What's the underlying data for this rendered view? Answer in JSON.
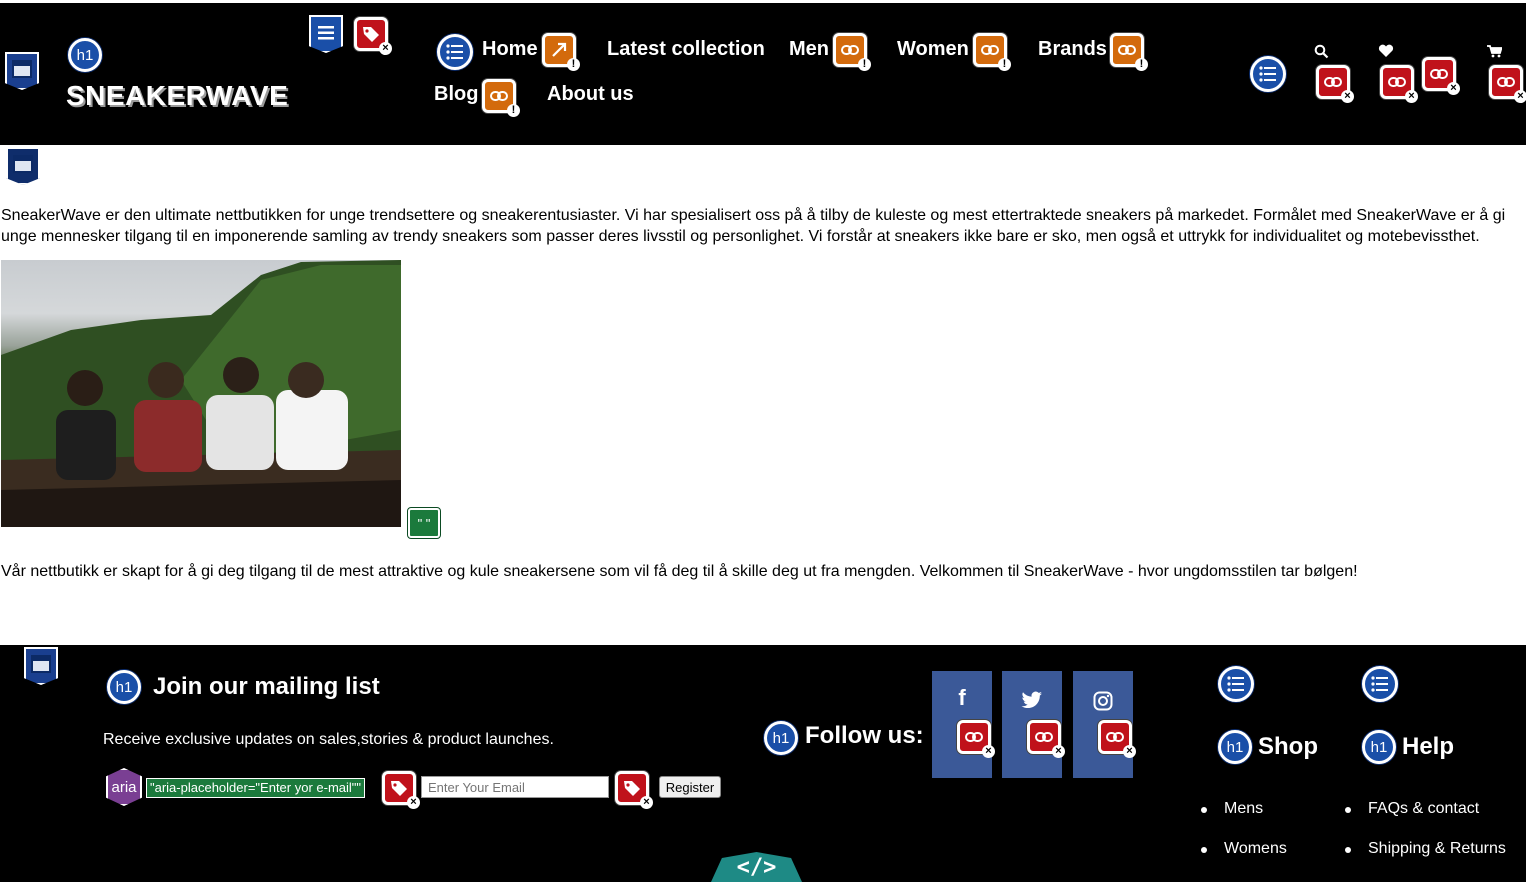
{
  "brand": {
    "logo_text": "SNEAKERWAVE"
  },
  "nav": {
    "items": [
      {
        "label": "Home"
      },
      {
        "label": "Latest collection"
      },
      {
        "label": "Men"
      },
      {
        "label": "Women"
      },
      {
        "label": "Brands"
      },
      {
        "label": "Blog"
      },
      {
        "label": "About us"
      }
    ]
  },
  "header_icons": [
    "search-icon",
    "heart-icon",
    "cart-icon"
  ],
  "main": {
    "intro": "SneakerWave er den ultimate nettbutikken for unge trendsettere og sneakerentusiaster. Vi har spesialisert oss på å tilby de kuleste og mest ettertraktede sneakers på markedet. Formålet med SneakerWave er å gi unge mennesker tilgang til en imponerende samling av trendy sneakers som passer deres livsstil og personlighet. Vi forstår at sneakers ikke bare er sko, men også et uttrykk for individualitet og motebevissthet.",
    "outro": "Vår nettbutikk er skapt for å gi deg tilgang til de mest attraktive og kule sneakersene som vil få deg til å skille deg ut fra mengden. Velkommen til SneakerWave - hvor ungdomsstilen tar bølgen!",
    "hero_alt_badge": "\" \""
  },
  "footer": {
    "mailing_title": "Join our mailing list",
    "mailing_text": "Receive exclusive updates on sales,stories & product launches.",
    "aria_note": "\"aria-placeholder=\"Enter yor e-mail\"\"",
    "email_placeholder": "Enter Your Email",
    "register_label": "Register",
    "follow_title": "Follow us:",
    "social": [
      "facebook-icon",
      "twitter-icon",
      "instagram-icon"
    ],
    "shop": {
      "title": "Shop",
      "items": [
        "Mens",
        "Womens"
      ]
    },
    "help": {
      "title": "Help",
      "items": [
        "FAQs & contact",
        "Shipping & Returns"
      ]
    },
    "code_toggle": "</>"
  },
  "overlay_labels": {
    "h1": "h1",
    "aria": "aria"
  },
  "colors": {
    "header_bg": "#000000",
    "footer_bg": "#000000",
    "social_bg": "#3b5998",
    "wave_blue": "#1a4fa8",
    "wave_red": "#c0121b",
    "wave_orange": "#d36a0c",
    "wave_green": "#1b7a3c",
    "wave_purple": "#7a3f93",
    "code_tab": "#1e8a85"
  }
}
